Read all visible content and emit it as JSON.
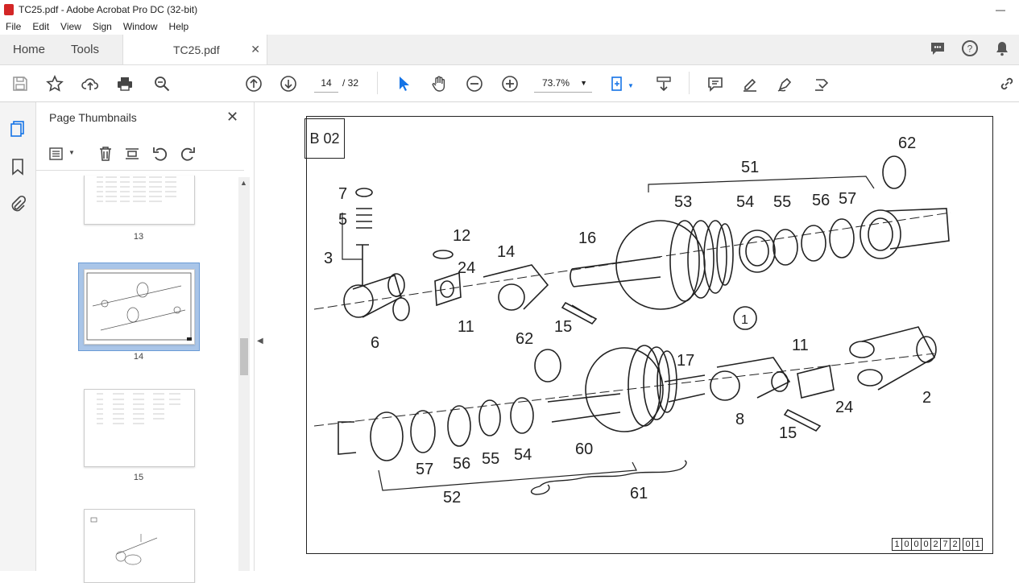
{
  "window": {
    "title": "TC25.pdf - Adobe Acrobat Pro DC (32-bit)"
  },
  "menu": [
    "File",
    "Edit",
    "View",
    "Sign",
    "Window",
    "Help"
  ],
  "tabs": {
    "home": "Home",
    "tools": "Tools",
    "document": "TC25.pdf"
  },
  "toolbar": {
    "page_current": "14",
    "page_total": "/ 32",
    "zoom": "73.7%"
  },
  "thumbnails": {
    "title": "Page Thumbnails",
    "pages": [
      {
        "label": "13"
      },
      {
        "label": "14",
        "selected": true
      },
      {
        "label": "15"
      }
    ]
  },
  "document": {
    "page_tag": "B 02",
    "circle_label": "1",
    "code_digits": [
      "1",
      "0",
      "0",
      "0",
      "2",
      "7",
      "2",
      "0",
      "1"
    ],
    "callouts": [
      "62",
      "51",
      "53",
      "54",
      "55",
      "56",
      "57",
      "7",
      "5",
      "3",
      "12",
      "14",
      "24",
      "16",
      "6",
      "11",
      "15",
      "62",
      "17",
      "11",
      "1",
      "2",
      "24",
      "8",
      "15",
      "57",
      "56",
      "55",
      "54",
      "60",
      "52",
      "61"
    ]
  },
  "colors": {
    "accent": "#1473e6",
    "pdf_icon": "#d32626",
    "selected_thumb": "#a9c5e8"
  }
}
